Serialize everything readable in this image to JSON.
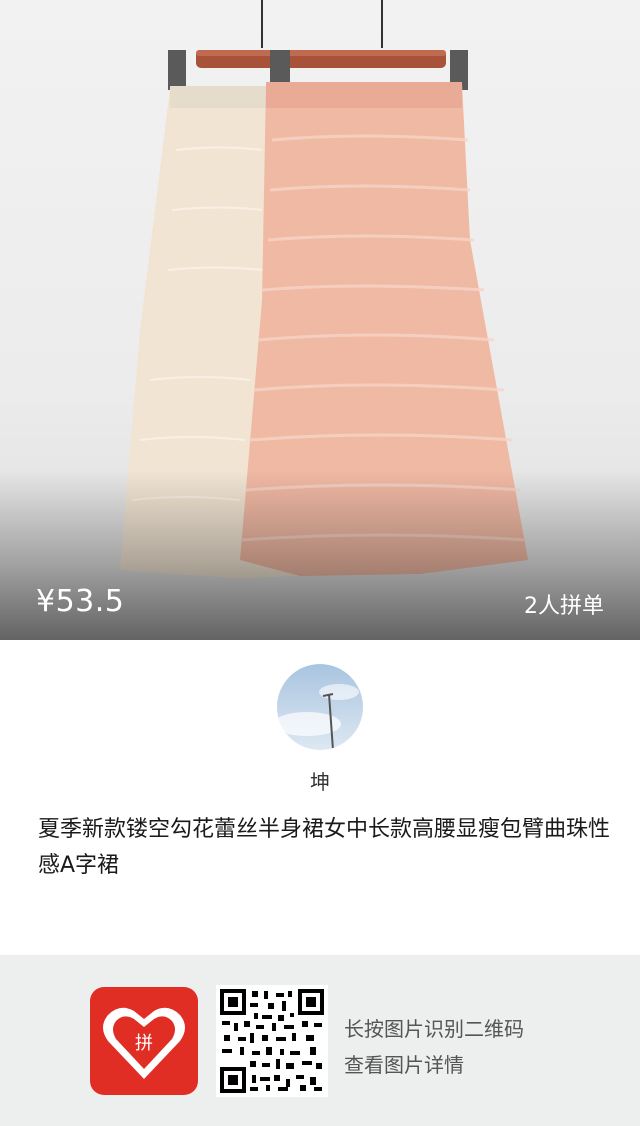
{
  "product": {
    "price": "¥53.5",
    "group_buy": "2人拼单",
    "title": "夏季新款镂空勾花蕾丝半身裙女中长款高腰显瘦包臂曲珠性感A字裙"
  },
  "author": {
    "name": "坤"
  },
  "footer": {
    "hint_line1": "长按图片识别二维码",
    "hint_line2": "查看图片详情",
    "logo_text": "拼"
  },
  "colors": {
    "brand_red": "#e02e24",
    "footer_bg": "#ecefed",
    "text_dark": "#1a1a1a",
    "text_gray": "#555555"
  }
}
